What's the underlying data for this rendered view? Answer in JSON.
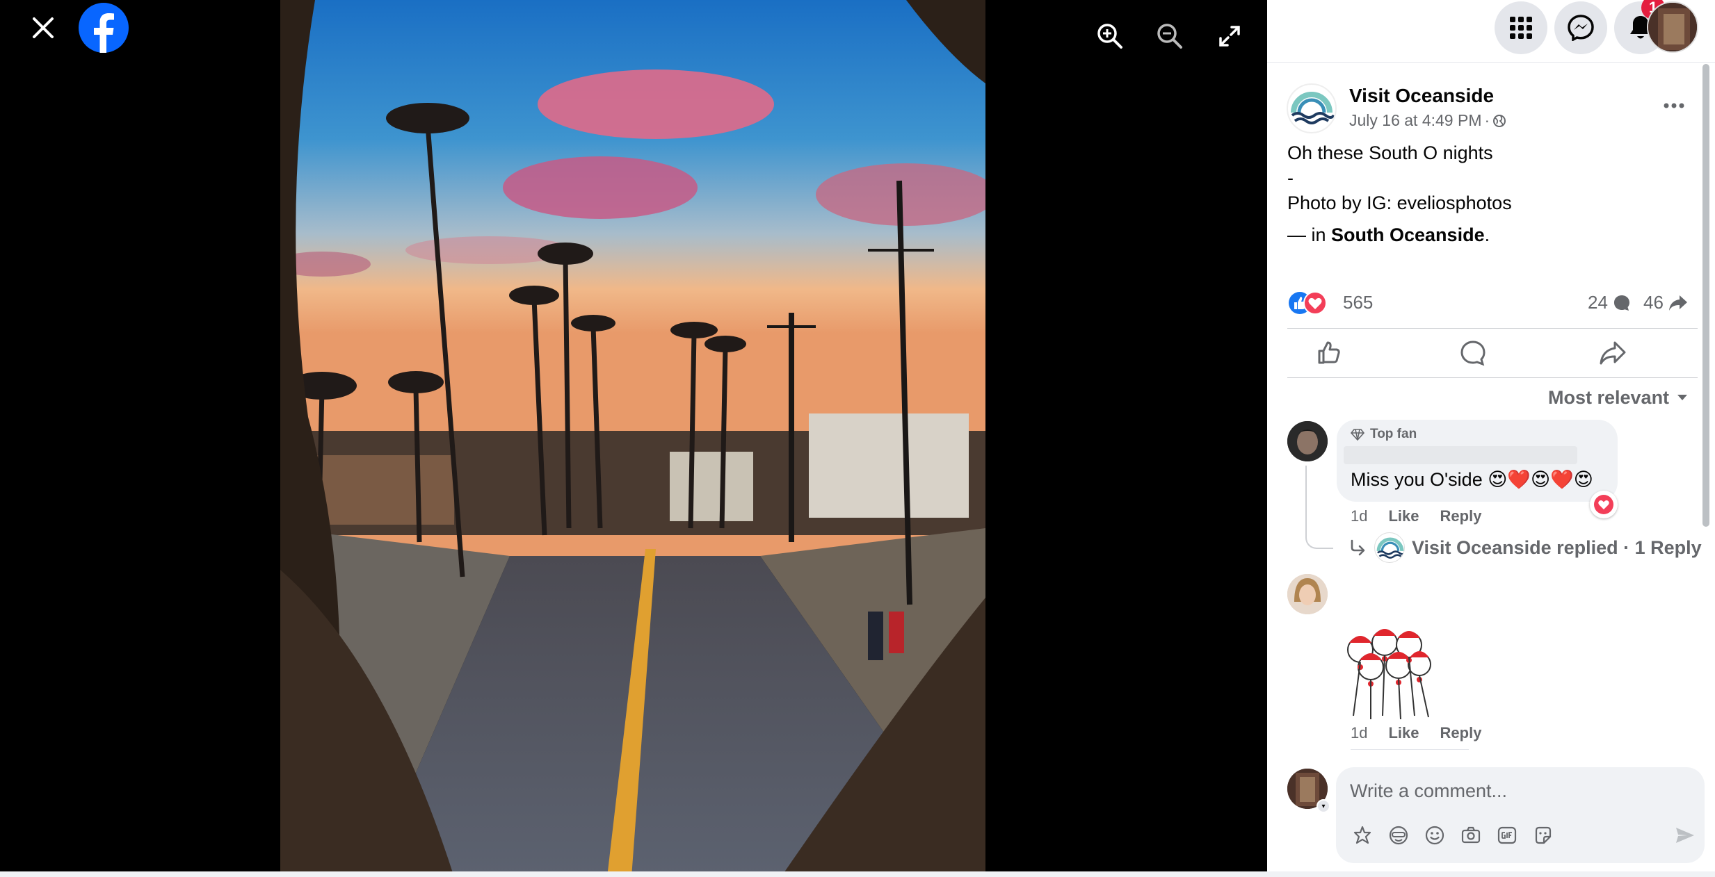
{
  "viewer": {
    "close_icon": "close-icon",
    "logo_icon": "facebook-logo-icon",
    "zoom_in_icon": "zoom-in-icon",
    "zoom_out_icon": "zoom-out-icon",
    "fullscreen_icon": "fullscreen-icon"
  },
  "topbar": {
    "menu_icon": "grid-menu-icon",
    "messenger_icon": "messenger-icon",
    "notifications_icon": "bell-icon",
    "notification_count": "1"
  },
  "post": {
    "page_name": "Visit Oceanside",
    "timestamp": "July 16 at 4:49 PM",
    "separator": "·",
    "audience_icon": "globe-icon",
    "text_line1": "Oh these South O nights",
    "text_line2": "-",
    "text_line3": "Photo by IG: eveliosphotos",
    "location_prefix": "— in ",
    "location": "South Oceanside",
    "location_suffix": ".",
    "reaction_count": "565",
    "comment_count": "24",
    "share_count": "46"
  },
  "actions": {
    "like_icon": "thumbs-up-icon",
    "comment_icon": "comment-bubble-icon",
    "share_icon": "share-arrow-icon"
  },
  "comments": {
    "sort_label": "Most relevant",
    "items": [
      {
        "badge": "Top fan",
        "text": "Miss you O'side 😍❤️😍❤️😍",
        "time": "1d",
        "like_label": "Like",
        "reply_label": "Reply",
        "replies_text": "Visit Oceanside replied · 1 Reply"
      },
      {
        "time": "1d",
        "like_label": "Like",
        "reply_label": "Reply"
      }
    ]
  },
  "composer": {
    "placeholder": "Write a comment...",
    "tools": [
      "avatar-sticker-icon",
      "emoji-mask-icon",
      "smiley-icon",
      "camera-icon",
      "gif-icon",
      "sticker-icon"
    ],
    "send_icon": "send-icon"
  },
  "colors": {
    "brand": "#0866ff",
    "badge": "#e41e3f",
    "secondary_text": "#65676b",
    "bubble": "#f0f2f5"
  }
}
